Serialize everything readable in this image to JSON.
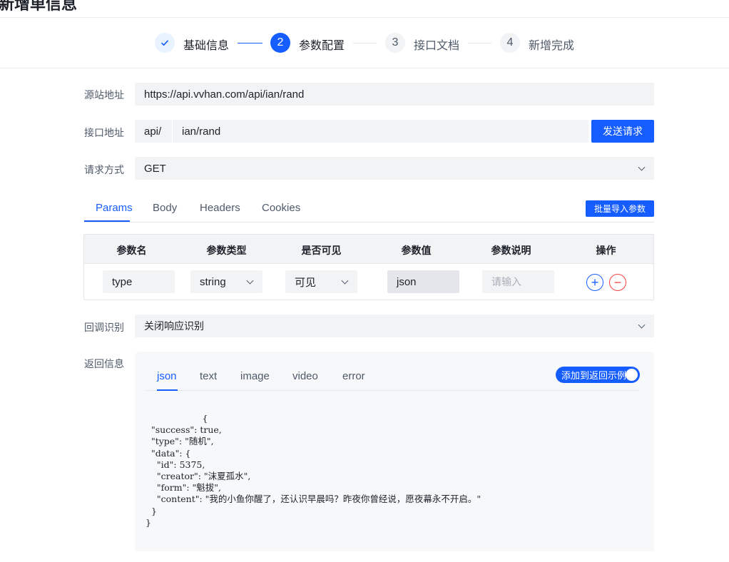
{
  "page": {
    "title": "新增单信息"
  },
  "steps": [
    {
      "index": "1",
      "label": "基础信息",
      "state": "done"
    },
    {
      "index": "2",
      "label": "参数配置",
      "state": "active"
    },
    {
      "index": "3",
      "label": "接口文档",
      "state": "todo"
    },
    {
      "index": "4",
      "label": "新增完成",
      "state": "todo"
    }
  ],
  "form": {
    "source_label": "源站地址",
    "source_value": "https://api.vvhan.com/api/ian/rand",
    "endpoint_label": "接口地址",
    "endpoint_prefix": "api/",
    "endpoint_value": "ian/rand",
    "send_button": "发送请求",
    "method_label": "请求方式",
    "method_value": "GET",
    "callback_label": "回调识别",
    "callback_value": "关闭响应识别",
    "response_label": "返回信息"
  },
  "request_tabs": {
    "items": [
      "Params",
      "Body",
      "Headers",
      "Cookies"
    ],
    "active": "Params",
    "import_button": "批量导入参数"
  },
  "params_table": {
    "headers": [
      "参数名",
      "参数类型",
      "是否可见",
      "参数值",
      "参数说明",
      "操作"
    ],
    "rows": [
      {
        "name": "type",
        "type": "string",
        "visible": "可见",
        "value": "json",
        "description_placeholder": "请输入"
      }
    ],
    "add_symbol": "+",
    "remove_symbol": "−"
  },
  "response_tabs": {
    "items": [
      "json",
      "text",
      "image",
      "video",
      "error"
    ],
    "active": "json",
    "toggle_label": "添加到返回示例",
    "toggle_on": true
  },
  "response_body": "                    {\n  \"success\": true,\n  \"type\": \"随机\",\n  \"data\": {\n    \"id\": 5375,\n    \"creator\": \"沫夏孤水\",\n    \"form\": \"魁拔\",\n    \"content\": \"我的小鱼你醒了，还认识早晨吗？昨夜你曾经说，愿夜幕永不开启。\"\n  }\n}",
  "colors": {
    "primary": "#165dff",
    "danger": "#f53f3f",
    "field_bg": "#f2f3f5"
  },
  "icons": {
    "step_done": "check-icon",
    "select": "chevron-down-icon",
    "add": "plus-circle-icon",
    "remove": "minus-circle-icon"
  }
}
